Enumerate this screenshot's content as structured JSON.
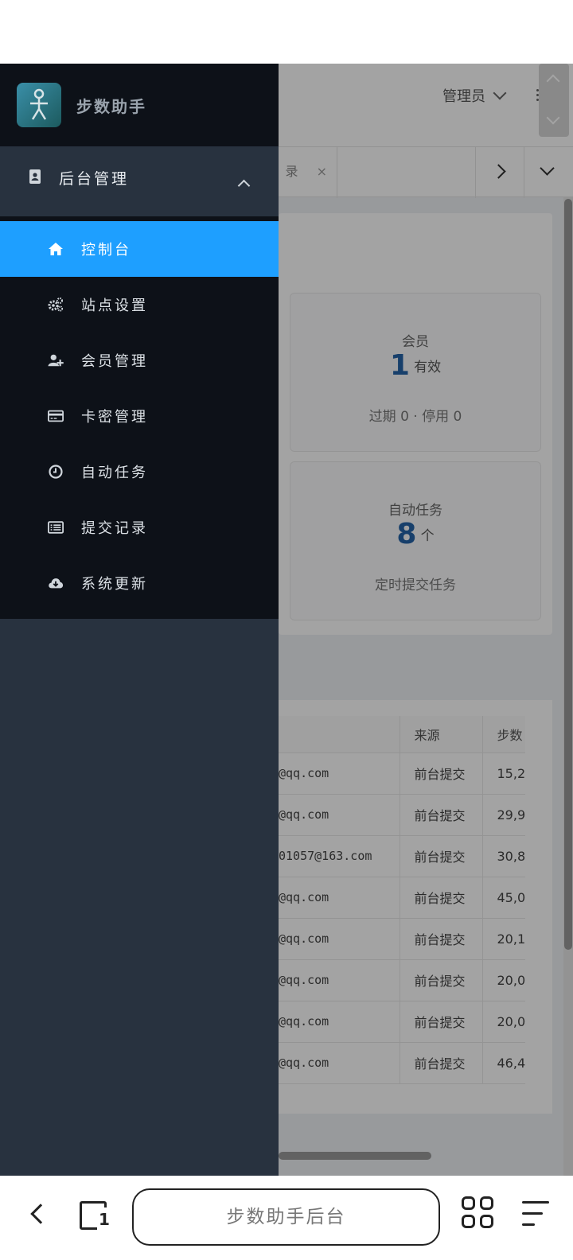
{
  "header": {
    "admin_label": "管理员",
    "tab_partial": "录"
  },
  "dashboard": {
    "members": {
      "label": "会员",
      "count": "1",
      "unit": "有效",
      "sub": "过期 0 · 停用 0"
    },
    "tasks": {
      "label": "自动任务",
      "count": "8",
      "unit": "个",
      "sub": "定时提交任务"
    }
  },
  "records_table": {
    "columns": [
      "来源",
      "步数"
    ],
    "rows": [
      {
        "email": "@qq.com",
        "source": "前台提交",
        "steps": "15,2"
      },
      {
        "email": "@qq.com",
        "source": "前台提交",
        "steps": "29,9"
      },
      {
        "email": "01057@163.com",
        "source": "前台提交",
        "steps": "30,8"
      },
      {
        "email": "@qq.com",
        "source": "前台提交",
        "steps": "45,0"
      },
      {
        "email": "@qq.com",
        "source": "前台提交",
        "steps": "20,1"
      },
      {
        "email": "@qq.com",
        "source": "前台提交",
        "steps": "20,0"
      },
      {
        "email": "@qq.com",
        "source": "前台提交",
        "steps": "20,0"
      },
      {
        "email": "@qq.com",
        "source": "前台提交",
        "steps": "46,4"
      }
    ]
  },
  "drawer": {
    "brand": "步数助手",
    "group_title": "后台管理",
    "items": [
      {
        "label": "控制台",
        "icon": "home-icon",
        "active": true
      },
      {
        "label": "站点设置",
        "icon": "gears-icon",
        "active": false
      },
      {
        "label": "会员管理",
        "icon": "user-add-icon",
        "active": false
      },
      {
        "label": "卡密管理",
        "icon": "credit-card-icon",
        "active": false
      },
      {
        "label": "自动任务",
        "icon": "clock-icon",
        "active": false
      },
      {
        "label": "提交记录",
        "icon": "list-icon",
        "active": false
      },
      {
        "label": "系统更新",
        "icon": "cloud-download-icon",
        "active": false
      }
    ]
  },
  "browser": {
    "url_title": "步数助手后台",
    "tab_count": "1"
  },
  "colors": {
    "drawer_dark": "#0d1118",
    "drawer_group": "#28323f",
    "active_item": "#1e9fff",
    "stat_number": "#2563a8"
  }
}
